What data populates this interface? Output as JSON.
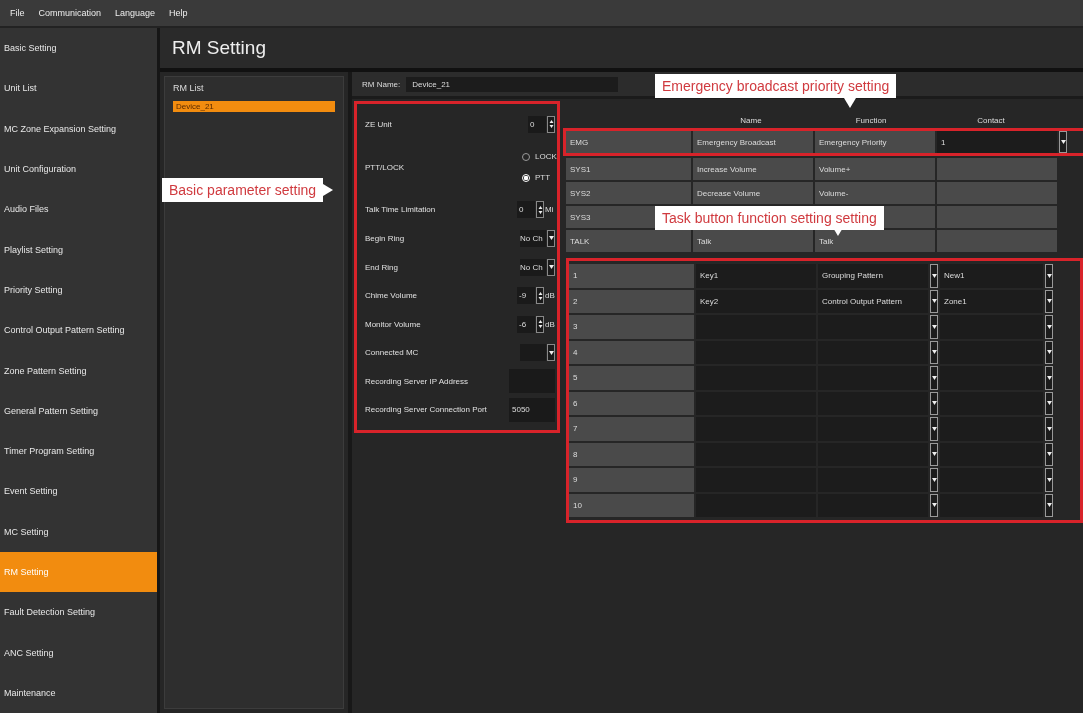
{
  "menu": [
    "File",
    "Communication",
    "Language",
    "Help"
  ],
  "sidebar": {
    "items": [
      {
        "label": "Basic Setting",
        "selected": false
      },
      {
        "label": "Unit List",
        "selected": false
      },
      {
        "label": "MC Zone Expansion Setting",
        "selected": false
      },
      {
        "label": "Unit Configuration",
        "selected": false
      },
      {
        "label": "Audio Files",
        "selected": false
      },
      {
        "label": "Playlist Setting",
        "selected": false
      },
      {
        "label": "Priority Setting",
        "selected": false
      },
      {
        "label": "Control Output Pattern Setting",
        "selected": false
      },
      {
        "label": "Zone Pattern Setting",
        "selected": false
      },
      {
        "label": "General Pattern Setting",
        "selected": false
      },
      {
        "label": "Timer Program Setting",
        "selected": false
      },
      {
        "label": "Event Setting",
        "selected": false
      },
      {
        "label": "MC Setting",
        "selected": false
      },
      {
        "label": "RM Setting",
        "selected": true
      },
      {
        "label": "Fault Detection Setting",
        "selected": false
      },
      {
        "label": "ANC Setting",
        "selected": false
      },
      {
        "label": "Maintenance",
        "selected": false
      }
    ]
  },
  "page_title": "RM Setting",
  "rm_list": {
    "title": "RM List",
    "items": [
      {
        "label": "Device_21",
        "selected": true
      }
    ]
  },
  "rm_name": {
    "label": "RM Name:",
    "value": "Device_21"
  },
  "form": {
    "callout": "Basic parameter setting",
    "rows": [
      {
        "kind": "spinner",
        "label": "ZE Unit",
        "value": "0"
      },
      {
        "kind": "radio",
        "label": "PTT/LOCK",
        "options": [
          {
            "label": "LOCK",
            "selected": false
          },
          {
            "label": "PTT",
            "selected": true
          }
        ]
      },
      {
        "kind": "spinner",
        "label": "Talk Time Limitation",
        "value": "0",
        "unit": "Mi"
      },
      {
        "kind": "combo",
        "label": "Begin Ring",
        "value": "No Ch"
      },
      {
        "kind": "combo",
        "label": "End Ring",
        "value": "No Ch"
      },
      {
        "kind": "spinner",
        "label": "Chime Volume",
        "value": "-9",
        "unit": "dB"
      },
      {
        "kind": "spinner",
        "label": "Monitor Volume",
        "value": "-6",
        "unit": "dB"
      },
      {
        "kind": "combo",
        "label": "Connected MC"
      },
      {
        "kind": "text",
        "label": "Recording Server IP Address"
      },
      {
        "kind": "text",
        "label": "Recording Server Connection Port",
        "value": "5050"
      }
    ]
  },
  "table": {
    "emergency_callout": "Emergency broadcast priority setting",
    "task_callout": "Task button function setting setting",
    "columns": [
      "Name",
      "Function",
      "Contact"
    ],
    "rows": [
      {
        "kind": "emergency",
        "key": "EMG",
        "name": "Emergency Broadcast",
        "function": "Emergency Priority",
        "contact": "1"
      },
      {
        "kind": "fixed",
        "key": "SYS1",
        "name": "Increase Volume",
        "function": "Volume+"
      },
      {
        "kind": "fixed",
        "key": "SYS2",
        "name": "Decrease Volume",
        "function": "Volume-"
      },
      {
        "kind": "fixed",
        "key": "SYS3"
      },
      {
        "kind": "fixed",
        "key": "TALK",
        "name": "Talk",
        "function": "Talk"
      },
      {
        "kind": "editable",
        "key": "1",
        "name": "Key1",
        "function": "Grouping Pattern",
        "contact": "New1"
      },
      {
        "kind": "editable",
        "key": "2",
        "name": "Key2",
        "function": "Control Output Pattern",
        "contact": "Zone1"
      },
      {
        "kind": "editable",
        "key": "3"
      },
      {
        "kind": "editable",
        "key": "4"
      },
      {
        "kind": "editable",
        "key": "5"
      },
      {
        "kind": "editable",
        "key": "6"
      },
      {
        "kind": "editable",
        "key": "7"
      },
      {
        "kind": "editable",
        "key": "8"
      },
      {
        "kind": "editable",
        "key": "9"
      },
      {
        "kind": "editable",
        "key": "10"
      }
    ]
  }
}
